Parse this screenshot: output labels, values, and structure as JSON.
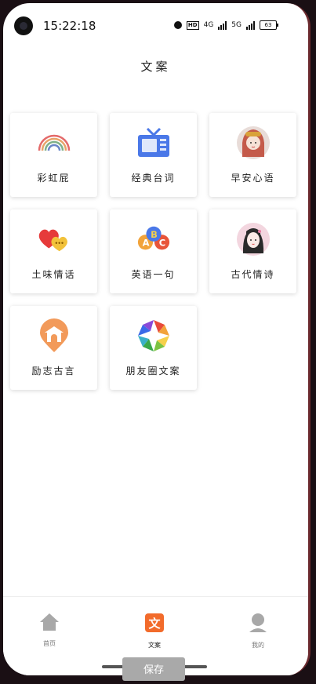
{
  "status_bar": {
    "time": "15:22:18",
    "network_1": "4G",
    "network_2": "5G",
    "battery": "63"
  },
  "page": {
    "title": "文案"
  },
  "categories": [
    {
      "label": "彩虹屁",
      "icon": "rainbow-icon"
    },
    {
      "label": "经典台词",
      "icon": "tv-icon"
    },
    {
      "label": "早安心语",
      "icon": "girl-avatar-icon"
    },
    {
      "label": "土味情话",
      "icon": "hearts-chat-icon"
    },
    {
      "label": "英语一句",
      "icon": "abc-balloons-icon"
    },
    {
      "label": "古代情诗",
      "icon": "ancient-girl-icon"
    },
    {
      "label": "励志古言",
      "icon": "temple-icon"
    },
    {
      "label": "朋友圈文案",
      "icon": "aperture-icon"
    }
  ],
  "tabbar": {
    "tabs": [
      {
        "label": "首页",
        "icon": "home-icon",
        "active": false
      },
      {
        "label": "文案",
        "icon": "wenan-icon",
        "active": true
      },
      {
        "label": "我的",
        "icon": "user-icon",
        "active": false
      }
    ]
  },
  "save_button": {
    "label": "保存"
  },
  "colors": {
    "accent": "#f26b2b",
    "inactive_icon": "#a8a8a8"
  }
}
